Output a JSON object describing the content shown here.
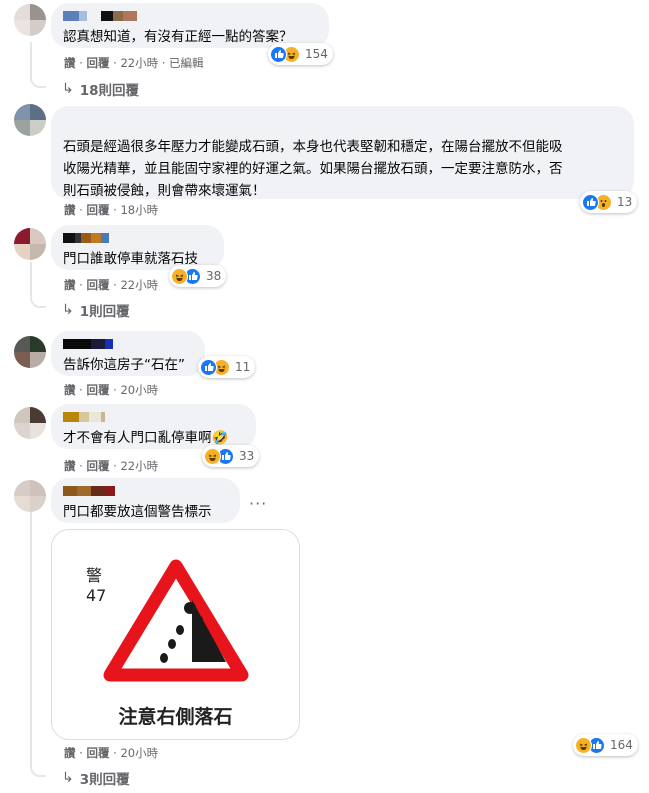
{
  "comments": [
    {
      "text": "認真想知道，有沒有正經一點的答案？",
      "meta": {
        "like": "讚",
        "reply": "回覆",
        "time": "22小時",
        "edited": "已編輯"
      },
      "reaction_count": "154",
      "replies_label": "18則回覆"
    },
    {
      "text": "石頭是經過很多年壓力才能變成石頭，本身也代表堅韌和穩定，在陽台擺放不但能吸\n收陽光精華，並且能固守家裡的好運之氣。如果陽台擺放石頭，一定要注意防水，否\n則石頭被侵蝕，則會帶來壞運氣！",
      "meta": {
        "like": "讚",
        "reply": "回覆",
        "time": "18小時"
      },
      "reaction_count": "13"
    },
    {
      "text": "門口誰敢停車就落石技",
      "meta": {
        "like": "讚",
        "reply": "回覆",
        "time": "22小時"
      },
      "reaction_count": "38",
      "replies_label": "1則回覆"
    },
    {
      "text": "告訴你這房子“石在”",
      "meta": {
        "like": "讚",
        "reply": "回覆",
        "time": "20小時"
      },
      "reaction_count": "11"
    },
    {
      "text": "才不會有人門口亂停車啊🤣",
      "meta": {
        "like": "讚",
        "reply": "回覆",
        "time": "22小時"
      },
      "reaction_count": "33"
    },
    {
      "text": "門口都要放這個警告標示",
      "meta": {
        "like": "讚",
        "reply": "回覆",
        "time": "20小時"
      },
      "reaction_count": "164",
      "replies_label": "3則回覆",
      "more_label": "···",
      "sign": {
        "code_top": "警",
        "code_bottom": "47",
        "caption": "注意右側落石"
      }
    }
  ],
  "symbols": {
    "reply_arrow": "↳"
  },
  "icons": [
    "like-icon",
    "haha-icon",
    "wow-icon",
    "reply-arrow-icon",
    "more-options-icon",
    "falling-rocks-warning-sign"
  ],
  "colors": {
    "bubble": "#f0f2f5",
    "meta_text": "#65676b",
    "like_blue": "#1877f2",
    "haha_yellow": "#f7b125",
    "sign_red": "#e8141b"
  }
}
